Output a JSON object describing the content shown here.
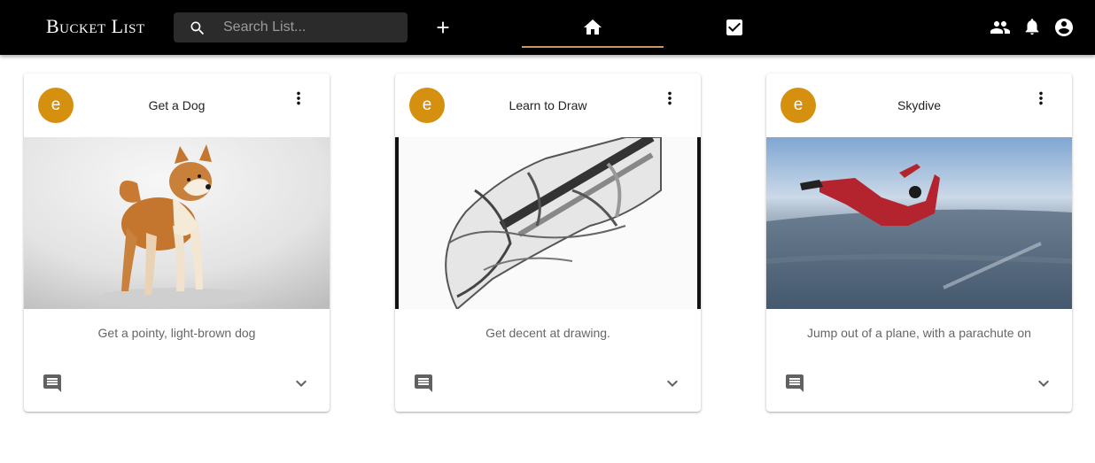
{
  "app": {
    "brand": "Bucket List"
  },
  "search": {
    "placeholder": "Search List...",
    "value": ""
  },
  "nav": {
    "add_icon": "plus-icon",
    "tabs": [
      {
        "icon": "home-icon",
        "active": true
      },
      {
        "icon": "checkbox-checked-icon",
        "active": false
      }
    ],
    "right_icons": [
      "people-icon",
      "bell-icon",
      "account-circle-icon"
    ]
  },
  "colors": {
    "appbar": "#000000",
    "accent_underline": "#c8966b",
    "avatar": "#d4900e"
  },
  "cards": [
    {
      "avatar": "e",
      "title": "Get a Dog",
      "description": "Get a pointy, light-brown dog",
      "image": "shiba-inu-dog-photo"
    },
    {
      "avatar": "e",
      "title": "Learn to Draw",
      "description": "Get decent at drawing.",
      "image": "pencil-sketch-hand-drawing"
    },
    {
      "avatar": "e",
      "title": "Skydive",
      "description": "Jump out of a plane, with a parachute on",
      "image": "skydiver-freefall-photo"
    }
  ]
}
